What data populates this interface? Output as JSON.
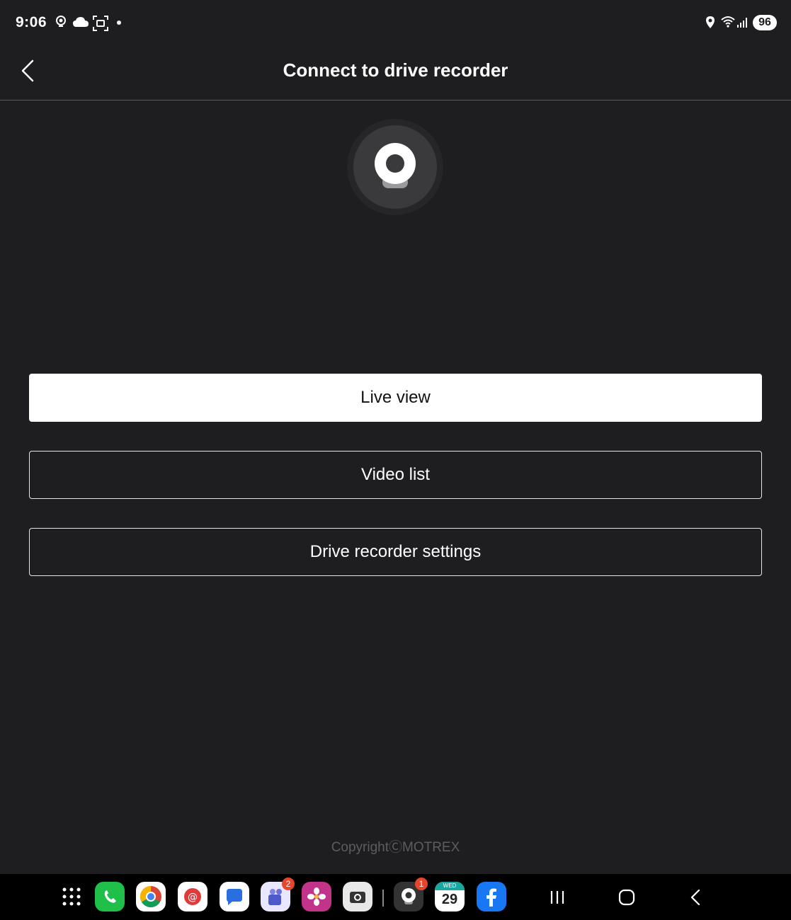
{
  "status_bar": {
    "time": "9:06",
    "battery": "96",
    "icons_left": [
      "location-target-icon",
      "cloud-icon",
      "screenshot-icon",
      "dot-icon"
    ],
    "icons_right": [
      "location-pin-icon",
      "wifi-icon",
      "signal-icon",
      "battery-icon"
    ]
  },
  "header": {
    "title": "Connect to drive recorder",
    "back_icon": "chevron-left-icon"
  },
  "device_icon": "dashcam-icon",
  "buttons": {
    "live_view": "Live view",
    "video_list": "Video list",
    "settings": "Drive recorder settings"
  },
  "footer": {
    "copyright": "CopyrightⒸMOTREX"
  },
  "taskbar": {
    "apps": [
      {
        "name": "apps-grid-icon"
      },
      {
        "name": "phone-app-icon",
        "color": "#1fbf4a"
      },
      {
        "name": "chrome-app-icon"
      },
      {
        "name": "email-app-icon",
        "color": "#e03a3a"
      },
      {
        "name": "messages-app-icon",
        "color": "#2a6fe0"
      },
      {
        "name": "teams-app-icon",
        "color": "#6b6fd6",
        "badge": "2"
      },
      {
        "name": "gallery-app-icon",
        "color": "#e83a7e"
      },
      {
        "name": "camera-app-icon"
      },
      {
        "name": "dashcam-app-icon",
        "badge": "1"
      },
      {
        "name": "calendar-app-icon",
        "day": "WED",
        "date": "29",
        "color": "#1aa6a0"
      },
      {
        "name": "facebook-app-icon",
        "color": "#1877f2"
      }
    ],
    "nav": [
      "recents-nav-icon",
      "home-nav-icon",
      "back-nav-icon"
    ]
  },
  "colors": {
    "background": "#1e1e20",
    "primary_button": "#ffffff",
    "copyright_text": "#5d5d60"
  }
}
